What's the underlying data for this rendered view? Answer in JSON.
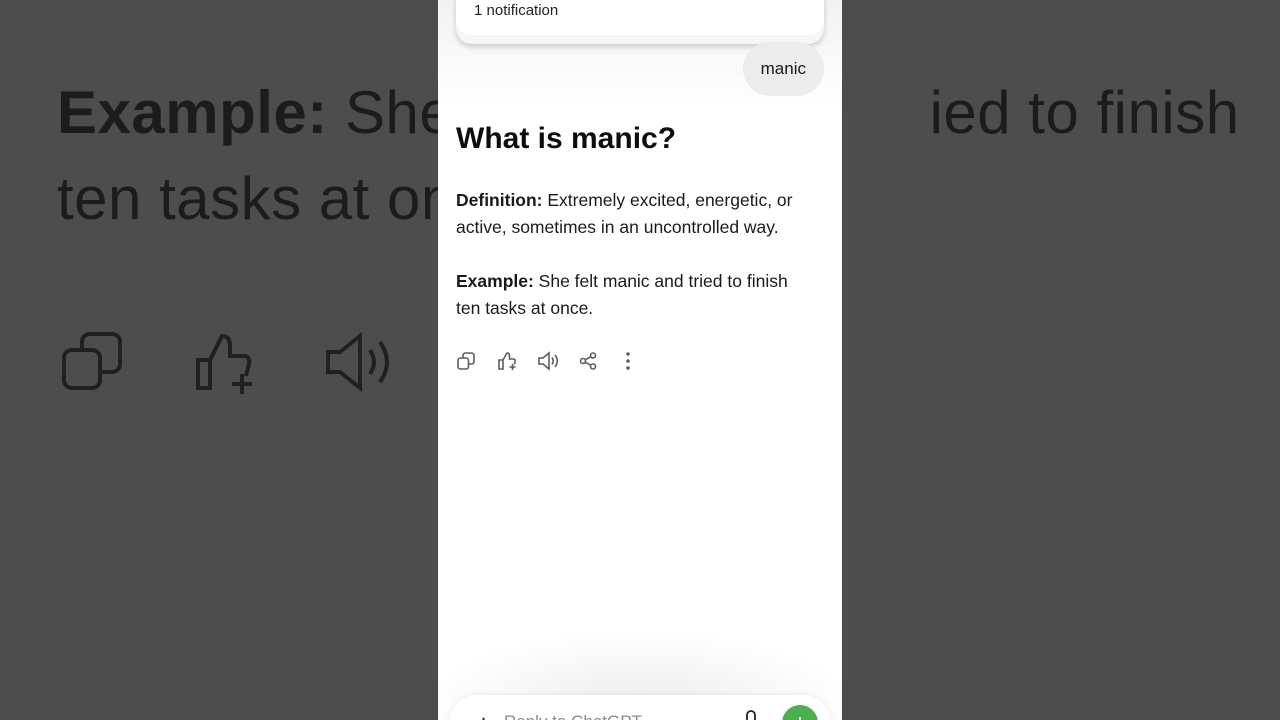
{
  "background": {
    "line1_bold": "Example:",
    "line1_rest": "She f",
    "line1_tail": "ied to finish",
    "line2": "ten tasks at on"
  },
  "notification": {
    "text": "1 notification"
  },
  "chat": {
    "user_message": "manic",
    "heading": "What is manic?",
    "definition_label": "Definition:",
    "definition_text": " Extremely excited, energetic, or active, sometimes in an uncontrolled way.",
    "example_label": "Example:",
    "example_text": " She felt manic and tried to finish ten tasks at once."
  },
  "actions": {
    "icons": [
      "copy-icon",
      "thumbs-up-icon",
      "speaker-icon",
      "share-icon",
      "more-icon"
    ]
  },
  "composer": {
    "placeholder": "Reply to ChatGPT",
    "accent_color": "#4caf50"
  }
}
